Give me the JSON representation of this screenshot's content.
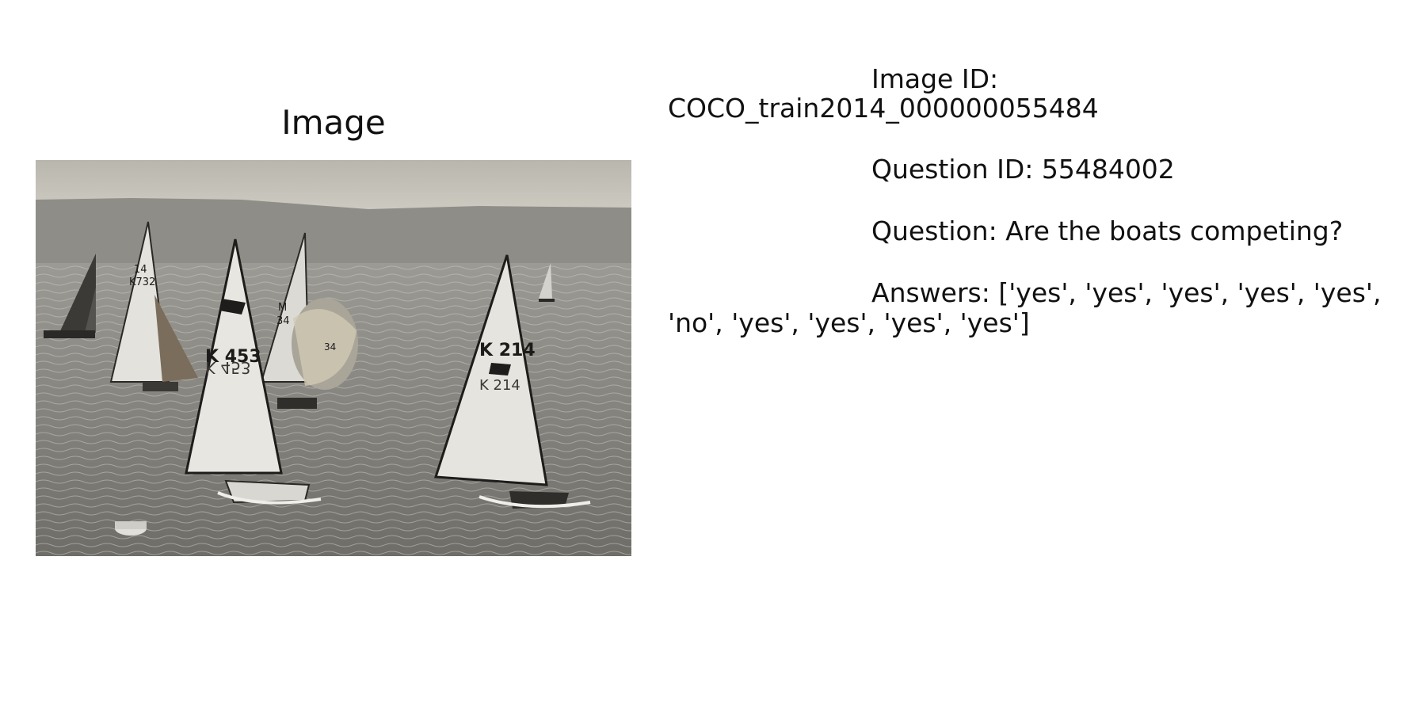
{
  "panel": {
    "title": "Image"
  },
  "photo": {
    "description_icon": "sailboat-race-photo",
    "sail_numbers": [
      "K 453",
      "K 214",
      "K732",
      "M 34",
      "14",
      "34"
    ]
  },
  "info": {
    "image_id_label": "Image ID:",
    "image_id_value": "COCO_train2014_000000055484",
    "question_id_line": "Question ID: 55484002",
    "question_line": "Question: Are the boats competing?",
    "answers_line1": "Answers: ['yes', 'yes', 'yes', 'yes', 'yes',",
    "answers_line2": "'no', 'yes', 'yes', 'yes', 'yes']"
  }
}
